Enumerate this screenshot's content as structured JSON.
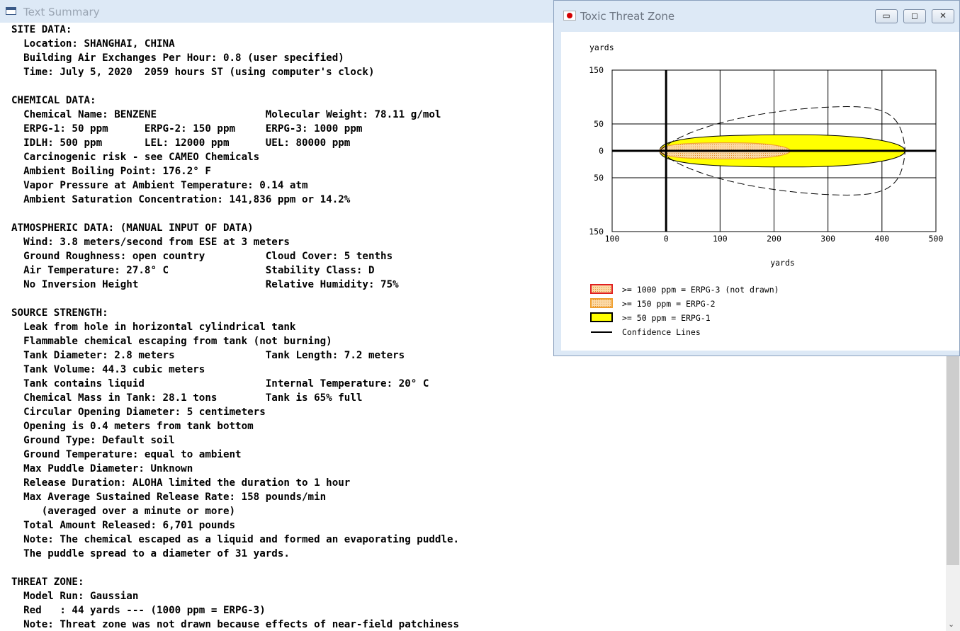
{
  "summary_window": {
    "title": "Text Summary",
    "lines": [
      "SITE DATA:",
      "  Location: SHANGHAI, CHINA",
      "  Building Air Exchanges Per Hour: 0.8 (user specified)",
      "  Time: July 5, 2020  2059 hours ST (using computer's clock)",
      "",
      "CHEMICAL DATA:",
      "  Chemical Name: BENZENE                  Molecular Weight: 78.11 g/mol",
      "  ERPG-1: 50 ppm      ERPG-2: 150 ppm     ERPG-3: 1000 ppm",
      "  IDLH: 500 ppm       LEL: 12000 ppm      UEL: 80000 ppm",
      "  Carcinogenic risk - see CAMEO Chemicals",
      "  Ambient Boiling Point: 176.2° F",
      "  Vapor Pressure at Ambient Temperature: 0.14 atm",
      "  Ambient Saturation Concentration: 141,836 ppm or 14.2%",
      "",
      "ATMOSPHERIC DATA: (MANUAL INPUT OF DATA)",
      "  Wind: 3.8 meters/second from ESE at 3 meters",
      "  Ground Roughness: open country          Cloud Cover: 5 tenths",
      "  Air Temperature: 27.8° C                Stability Class: D",
      "  No Inversion Height                     Relative Humidity: 75%",
      "",
      "SOURCE STRENGTH:",
      "  Leak from hole in horizontal cylindrical tank",
      "  Flammable chemical escaping from tank (not burning)",
      "  Tank Diameter: 2.8 meters               Tank Length: 7.2 meters",
      "  Tank Volume: 44.3 cubic meters",
      "  Tank contains liquid                    Internal Temperature: 20° C",
      "  Chemical Mass in Tank: 28.1 tons        Tank is 65% full",
      "  Circular Opening Diameter: 5 centimeters",
      "  Opening is 0.4 meters from tank bottom",
      "  Ground Type: Default soil",
      "  Ground Temperature: equal to ambient",
      "  Max Puddle Diameter: Unknown",
      "  Release Duration: ALOHA limited the duration to 1 hour",
      "  Max Average Sustained Release Rate: 158 pounds/min",
      "     (averaged over a minute or more)",
      "  Total Amount Released: 6,701 pounds",
      "  Note: The chemical escaped as a liquid and formed an evaporating puddle.",
      "  The puddle spread to a diameter of 31 yards.",
      "",
      "THREAT ZONE:",
      "  Model Run: Gaussian",
      "  Red   : 44 yards --- (1000 ppm = ERPG-3)",
      "  Note: Threat zone was not drawn because effects of near-field patchiness"
    ]
  },
  "threat_window": {
    "title": "Toxic Threat Zone",
    "buttons": [
      "minimize",
      "maximize",
      "close"
    ]
  },
  "chart_data": {
    "type": "area",
    "title": "",
    "ylabel": "yards",
    "xlabel": "yards",
    "x_ticks": [
      "100",
      "0",
      "100",
      "200",
      "300",
      "400",
      "500"
    ],
    "y_ticks": [
      "150",
      "50",
      "0",
      "50",
      "150"
    ],
    "xlim": [
      -100,
      500
    ],
    "ylim": [
      -150,
      150
    ],
    "grid": true,
    "legend_position": "bottom-left",
    "zones": [
      {
        "name": ">= 1000 ppm = ERPG-3 (not drawn)",
        "color": "#e02020",
        "drawn": false
      },
      {
        "name": ">= 150 ppm = ERPG-2",
        "color": "#ffb347",
        "x_start": -12,
        "x_end": 230,
        "half_width": 15
      },
      {
        "name": ">= 50 ppm = ERPG-1",
        "color": "#ffff00",
        "x_start": -12,
        "x_end": 443,
        "half_width": 30
      },
      {
        "name": "Confidence Lines",
        "color": "#000000",
        "x_start": -12,
        "x_end": 443,
        "half_width": 85
      }
    ]
  }
}
